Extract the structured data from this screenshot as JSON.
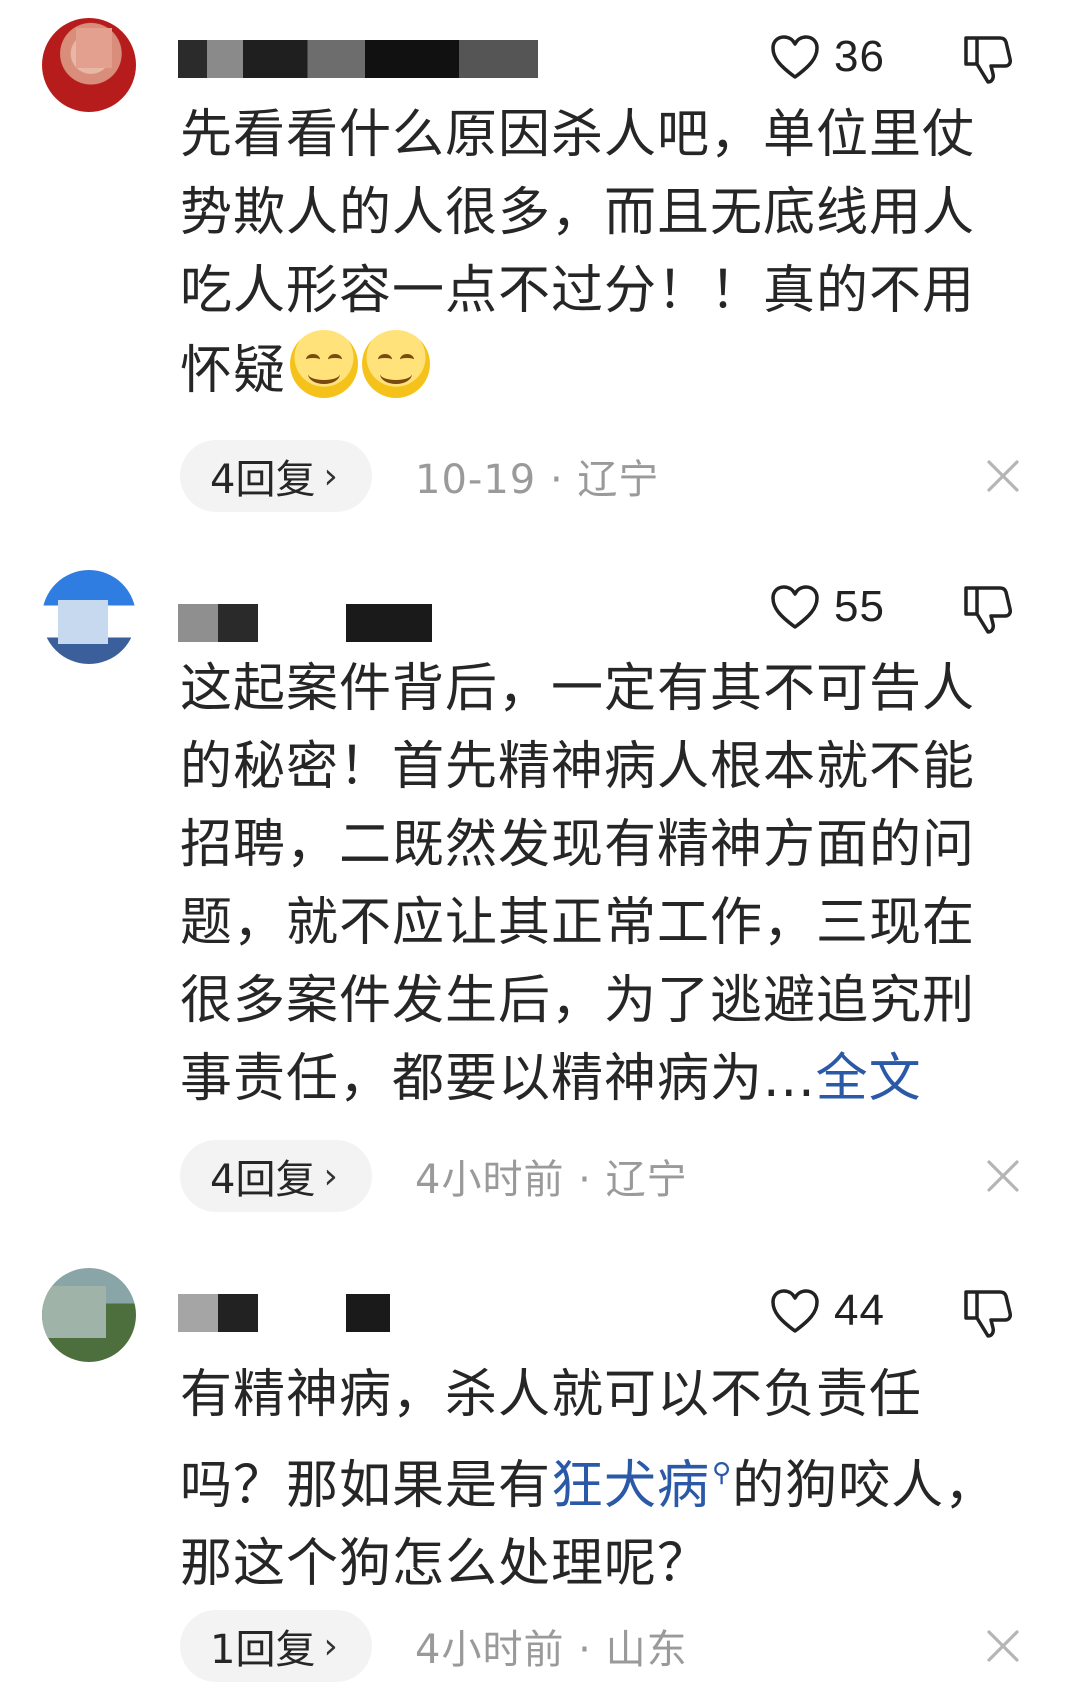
{
  "icons": {
    "like": "heart-outline-icon",
    "dislike": "thumbs-down-outline-icon",
    "close": "close-icon",
    "reply_chevron": "chevron-right-icon",
    "emoji": "smiling-face-emoji-icon",
    "search_suffix": "search-icon"
  },
  "colors": {
    "link": "#2a59a8",
    "meta_text": "#9a9a9a",
    "reply_bg": "#f3f3f3"
  },
  "comments": [
    {
      "likes": "36",
      "content": "先看看什么原因杀人吧，单位里仗势欺人的人很多，而且无底线用人吃人形容一点不过分！！真的不用怀疑",
      "emoji_count": 2,
      "reply_label": "4回复",
      "meta": "10-19 · 辽宁"
    },
    {
      "likes": "55",
      "content": "这起案件背后，一定有其不可告人的秘密！首先精神病人根本就不能招聘，二既然发现有精神方面的问题，就不应让其正常工作，三现在很多案件发生后，为了逃避追究刑事责任，都要以精神病为",
      "ellipsis": "...",
      "full_text_link": "全文",
      "reply_label": "4回复",
      "meta": "4小时前 · 辽宁"
    },
    {
      "likes": "44",
      "content_before": "有精神病，杀人就可以不负责任吗？那如果是有",
      "keyword_link": "狂犬病",
      "content_after": "的狗咬人，那这个狗怎么处理呢？",
      "reply_label": "1回复",
      "meta": "4小时前 · 山东"
    }
  ],
  "reply_chevron": "›"
}
